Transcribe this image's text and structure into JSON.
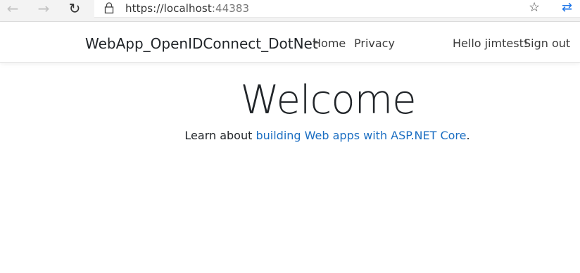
{
  "browser": {
    "back_icon": "←",
    "forward_icon": "→",
    "refresh_icon": "↻",
    "url_host": "https://localhost",
    "url_port": ":44383",
    "favorite_icon": "☆",
    "extension_icon": "⇄"
  },
  "navbar": {
    "brand": "WebApp_OpenIDConnect_DotNet",
    "links": [
      "Home",
      "Privacy"
    ],
    "user_greeting": "Hello jimtest!",
    "sign_out": "Sign out"
  },
  "main": {
    "heading": "Welcome",
    "text_before": "Learn about ",
    "link_text": "building Web apps with ASP.NET Core",
    "text_after": "."
  },
  "colors": {
    "link": "#1b6ec2",
    "text": "#212529",
    "browser_chrome": "#f3f3f3"
  }
}
